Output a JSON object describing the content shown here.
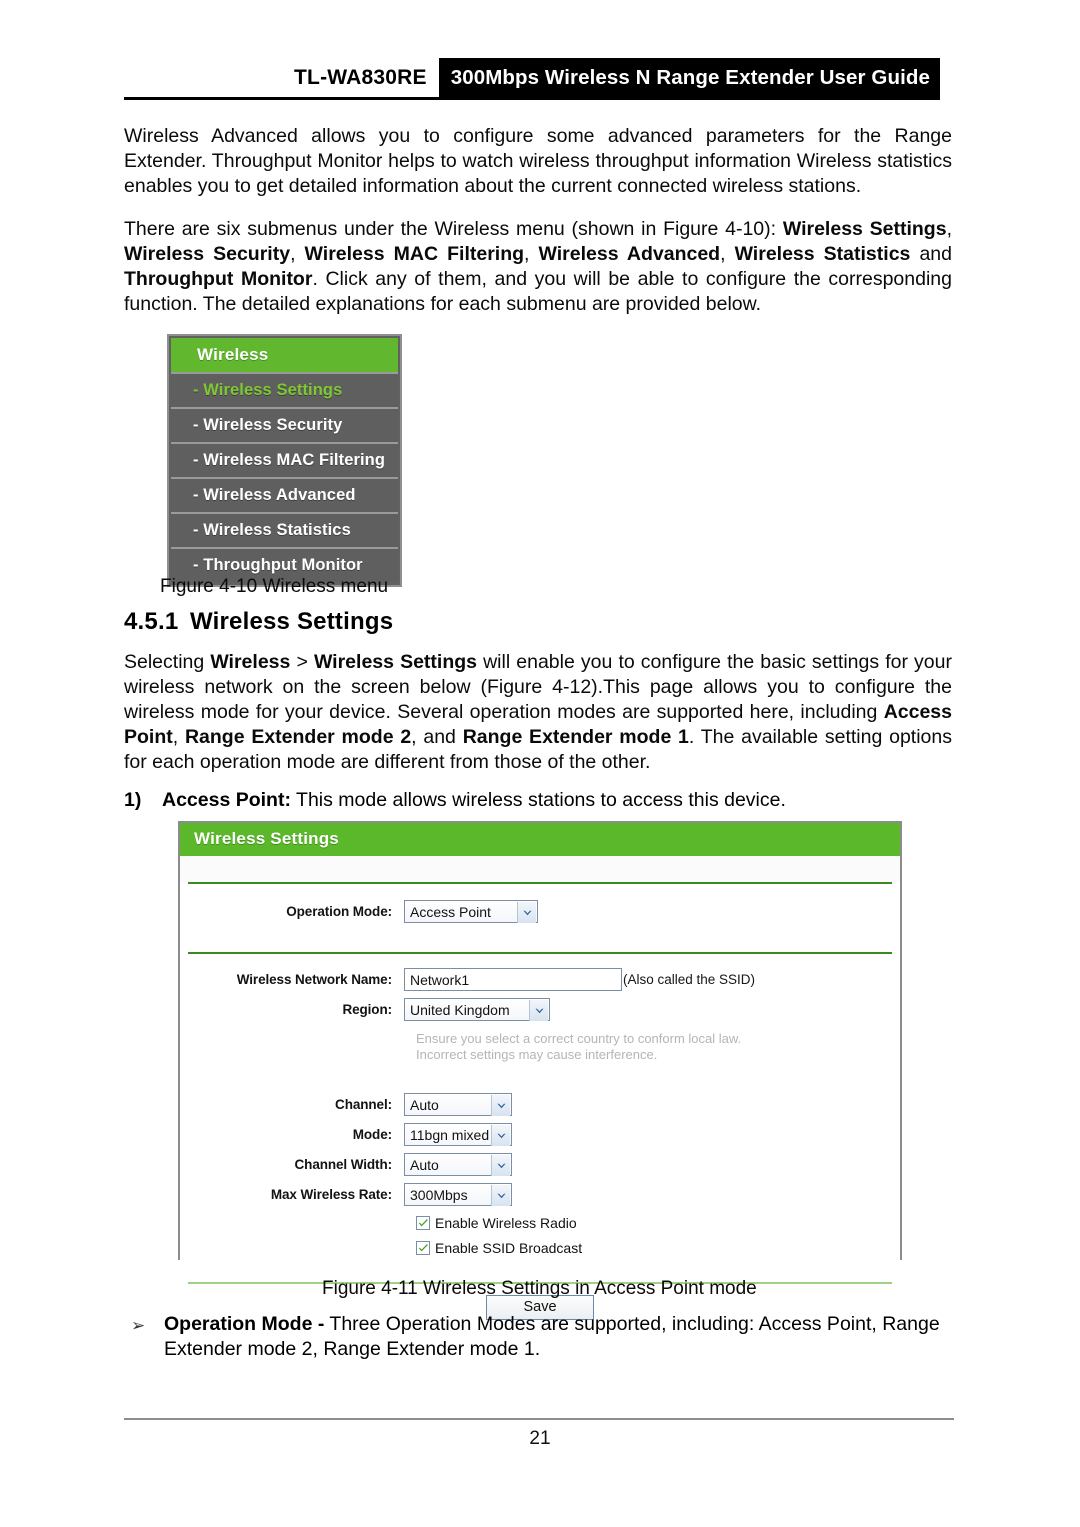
{
  "header": {
    "model": "TL-WA830RE",
    "guide_title": "300Mbps Wireless N Range Extender User Guide"
  },
  "intro": {
    "paragraph1_part1": "Wireless Advanced allows you to configure some advanced parameters for the Range Extender. Throughput Monitor helps to watch wireless throughput information Wireless statistics enables you to get detailed information about the current connected wireless stations.",
    "paragraph2": {
      "t1": "There are six submenus under the Wireless menu (shown in ",
      "t2": "Figure 4-10",
      "t3": "): ",
      "b1": "Wireless Settings",
      "t4": ", ",
      "b2": "Wireless Security",
      "t5": ", ",
      "b3": "Wireless MAC Filtering",
      "t6": ", ",
      "b4": "Wireless Advanced",
      "t7": ", ",
      "b5": "Wireless Statistics",
      "t8": " and ",
      "b6": "Throughput Monitor",
      "t9": ". Click any of them, and you will be able to configure the corresponding function. The detailed explanations for each submenu are provided below."
    }
  },
  "wireless_menu": {
    "header_label": "Wireless",
    "items": [
      {
        "label": "- Wireless Settings",
        "active": true
      },
      {
        "label": "- Wireless Security",
        "active": false
      },
      {
        "label": "- Wireless MAC Filtering",
        "active": false
      },
      {
        "label": "- Wireless Advanced",
        "active": false
      },
      {
        "label": "- Wireless Statistics",
        "active": false
      },
      {
        "label": "- Throughput Monitor",
        "active": false
      }
    ],
    "caption": "Figure 4-10 Wireless menu"
  },
  "section": {
    "number": "4.5.1",
    "title": "Wireless Settings",
    "paragraph": {
      "t1": "Selecting ",
      "b1": "Wireless",
      "t2": " > ",
      "b2": "Wireless Settings",
      "t3": " will enable you to configure the basic settings for your wireless network on the screen below (Figure 4-12).This page allows you to configure the wireless mode for your device. Several operation modes are supported here, including ",
      "b3": "Access Point",
      "t4": ", ",
      "b4": "Range Extender mode 2",
      "t5": ", and ",
      "b5": "Range Extender mode 1",
      "t6": ". The available setting options for each operation mode are different from those of the other."
    },
    "numbered_item": {
      "marker": "1)",
      "bold": "Access Point:",
      "text": " This mode allows wireless stations to access this device."
    }
  },
  "wireless_settings_panel": {
    "title": "Wireless Settings",
    "operation_mode": {
      "label": "Operation Mode:",
      "value": "Access Point"
    },
    "network_name": {
      "label": "Wireless Network Name:",
      "value": "Network1",
      "note": "(Also called the SSID)"
    },
    "region": {
      "label": "Region:",
      "value": "United Kingdom",
      "hint_line1": "Ensure you select a correct country to conform local law.",
      "hint_line2": "Incorrect settings may cause interference."
    },
    "channel": {
      "label": "Channel:",
      "value": "Auto"
    },
    "mode": {
      "label": "Mode:",
      "value": "11bgn mixed"
    },
    "channel_width": {
      "label": "Channel Width:",
      "value": "Auto"
    },
    "max_wireless_rate": {
      "label": "Max Wireless Rate:",
      "value": "300Mbps"
    },
    "enable_wireless_radio": {
      "label": "Enable Wireless Radio",
      "checked": true
    },
    "enable_ssid_broadcast": {
      "label": "Enable SSID Broadcast",
      "checked": true
    },
    "save_button": "Save",
    "caption": "Figure 4-11 Wireless Settings in Access Point mode",
    "colors": {
      "title_bar_green": "#5cb82b",
      "divider_green": "#3a8a20",
      "hint_gray": "#b5b5b5",
      "check_green": "#3fa024"
    }
  },
  "bullet_item": {
    "arrow": "➢",
    "bold": "Operation Mode -",
    "text": " Three Operation Modes are supported, including: Access Point, Range Extender mode 2, Range Extender mode 1."
  },
  "footer": {
    "page_number": "21"
  }
}
